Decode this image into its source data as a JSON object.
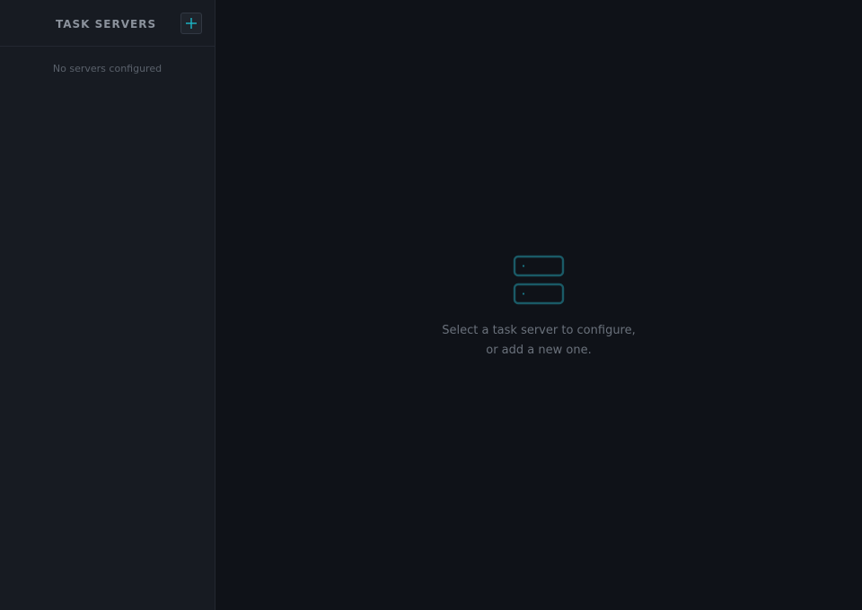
{
  "sidebar": {
    "title": "TASK SERVERS",
    "add_button_icon": "plus-icon",
    "empty_message": "No servers configured"
  },
  "main": {
    "empty_state": {
      "icon": "server-icon",
      "line1": "Select a task server to configure,",
      "line2": "or add a new one."
    }
  },
  "colors": {
    "accent": "#1bb8c9",
    "icon_stroke": "#1a5a66",
    "sidebar_bg": "#171b22",
    "main_bg": "#0f1218"
  }
}
